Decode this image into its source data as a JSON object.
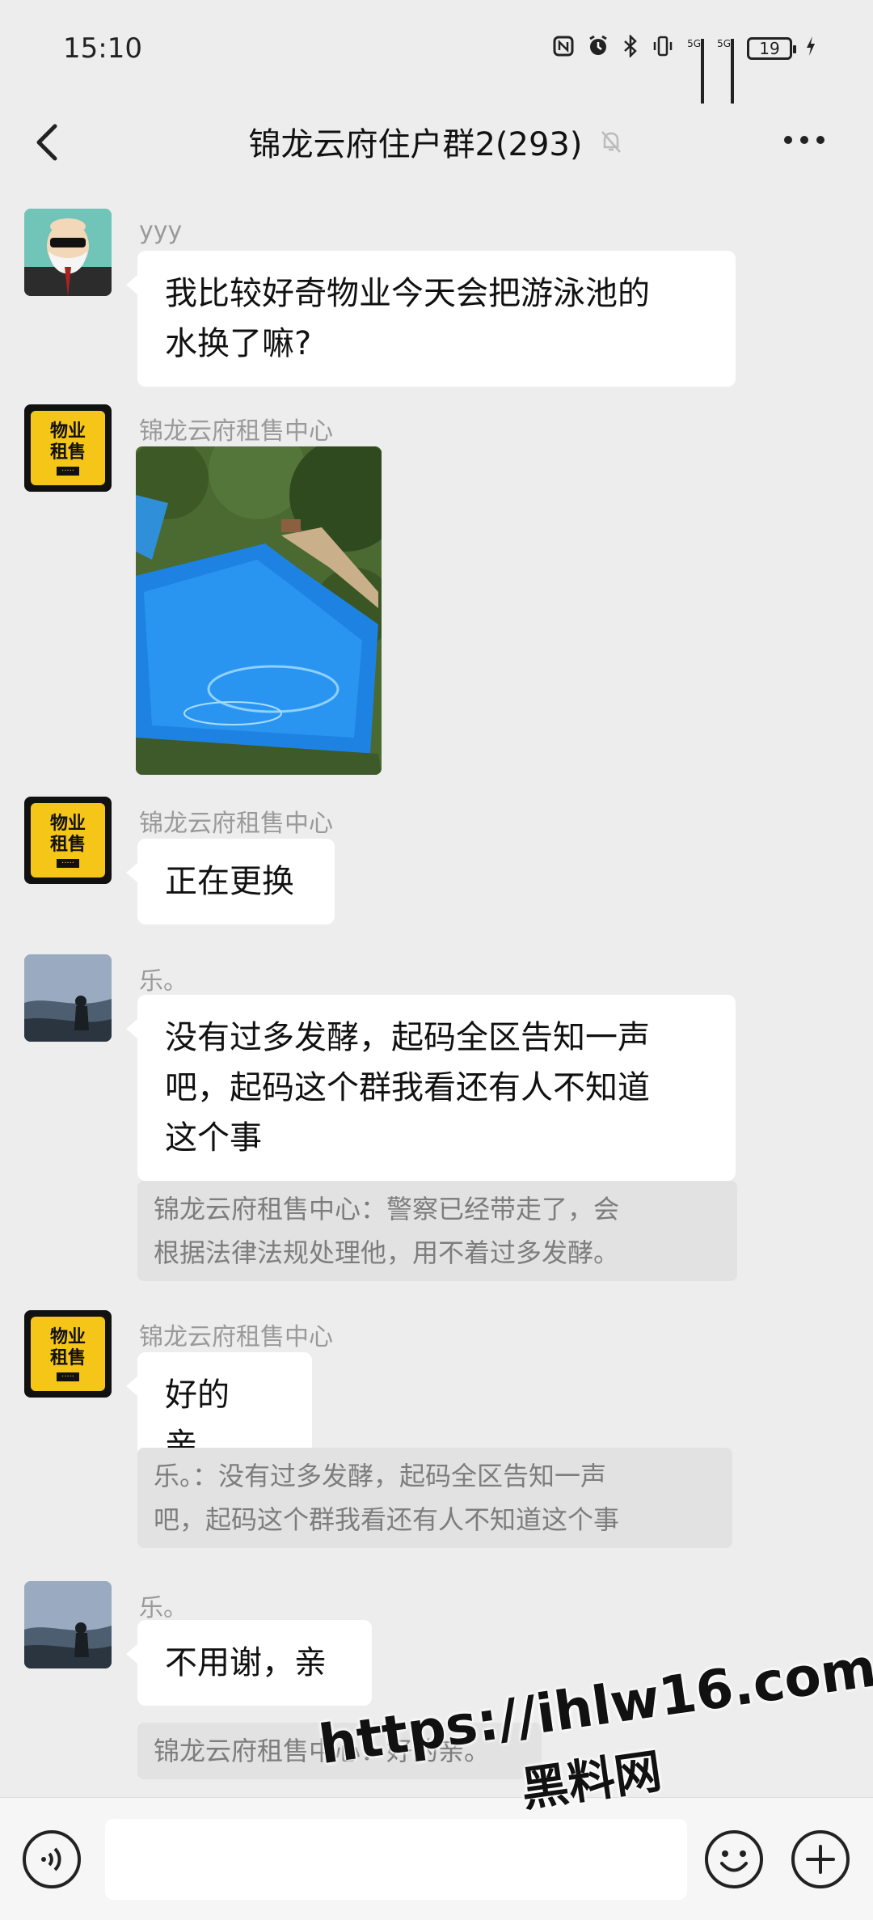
{
  "status_bar": {
    "time": "15:10",
    "icons": [
      "nfc-icon",
      "alarm-icon",
      "bluetooth-icon",
      "vibrate-icon",
      "signal-5g-icon",
      "signal-5g-icon"
    ],
    "signal1_label": "5G",
    "signal2_label": "5G",
    "battery_level": "19"
  },
  "header": {
    "title": "锦龙云府住户群2(293)",
    "back_icon": "chevron-left-icon",
    "mute_icon": "bell-off-icon",
    "more_icon": "more-icon"
  },
  "messages": [
    {
      "sender": "yyy",
      "text_lines": [
        "我比较好奇物业今天会把游泳池的",
        "水换了嘛?"
      ]
    },
    {
      "sender": "锦龙云府租售中心",
      "type": "image"
    },
    {
      "sender": "锦龙云府租售中心",
      "text_lines": [
        "正在更换"
      ]
    },
    {
      "sender": "乐。",
      "text_lines": [
        "没有过多发酵，起码全区告知一声",
        "吧，起码这个群我看还有人不知道",
        "这个事"
      ],
      "quote_lines": [
        "锦龙云府租售中心：警察已经带走了，会",
        "根据法律法规处理他，用不着过多发酵。"
      ]
    },
    {
      "sender": "锦龙云府租售中心",
      "text_lines": [
        "好的亲。"
      ],
      "quote_lines": [
        "乐。：没有过多发酵，起码全区告知一声",
        "吧，起码这个群我看还有人不知道这个事"
      ]
    },
    {
      "sender": "乐。",
      "text_lines": [
        "不用谢，亲"
      ],
      "quote_lines": [
        "锦龙云府租售中心：好的亲。"
      ]
    }
  ],
  "avatar_property_text": {
    "line1": "物业",
    "line2": "租售"
  },
  "bottom_bar": {
    "voice_icon": "voice-icon",
    "emoji_icon": "emoji-icon",
    "plus_icon": "plus-icon"
  },
  "watermark": {
    "url": "https://ihlw16.com",
    "name": "黑料网"
  },
  "colors": {
    "background": "#ededed",
    "bubble": "#ffffff",
    "quote": "#e2e2e2",
    "property_yellow": "#f5c518"
  }
}
